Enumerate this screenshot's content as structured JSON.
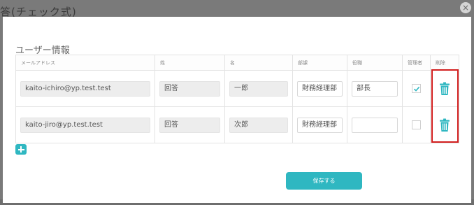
{
  "backdrop": {
    "title": "答(チェック式)"
  },
  "modal": {
    "close_label": "×",
    "section_title": "ユーザー情報",
    "columns": [
      "メールアドレス",
      "姓",
      "名",
      "部課",
      "役職",
      "管理者",
      "削除"
    ],
    "rows": [
      {
        "email": "kaito-ichiro@yp.test.test",
        "last_name": "回答",
        "first_name": "一郎",
        "department": "財務経理部",
        "position": "部長",
        "admin": true
      },
      {
        "email": "kaito-jiro@yp.test.test",
        "last_name": "回答",
        "first_name": "次郎",
        "department": "財務経理部",
        "position": "",
        "admin": false
      }
    ],
    "save_label": "保存する"
  },
  "icons": {
    "add": "plus-icon",
    "delete": "trash-icon",
    "close": "close-icon",
    "check": "check-icon"
  },
  "colors": {
    "accent": "#2fb7c1",
    "highlight": "#d21f1f",
    "trash": "#2fb7c1"
  }
}
